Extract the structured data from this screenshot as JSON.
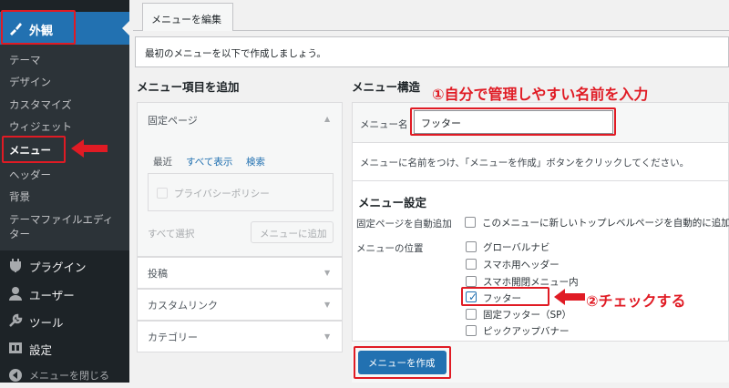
{
  "sidebar": {
    "appearance": "外観",
    "submenu": [
      "テーマ",
      "デザイン",
      "カスタマイズ",
      "ウィジェット",
      "メニュー",
      "ヘッダー",
      "背景",
      "テーマファイルエディ",
      "ター"
    ],
    "main": [
      "プラグイン",
      "ユーザー",
      "ツール",
      "設定",
      "メニューを閉じる"
    ]
  },
  "tab": "メニューを編集",
  "notice": "最初のメニューを以下で作成しましょう。",
  "add_items": {
    "heading": "メニュー項目を追加",
    "fixed_page": "固定ページ",
    "inner_tabs": [
      "最近",
      "すべて表示",
      "検索"
    ],
    "privacy": "プライバシーポリシー",
    "select_all": "すべて選択",
    "add_button": "メニューに追加",
    "sections": [
      "投稿",
      "カスタムリンク",
      "カテゴリー"
    ]
  },
  "structure": {
    "heading": "メニュー構造",
    "name_label": "メニュー名",
    "name_value": "フッター",
    "desc": "メニューに名前をつけ、「メニューを作成」ボタンをクリックしてください。",
    "settings_heading": "メニュー設定",
    "auto_add_label": "固定ページを自動追加",
    "auto_add_text": "このメニューに新しいトップレベルページを自動的に追加",
    "position_label": "メニューの位置",
    "positions": [
      "グローバルナビ",
      "スマホ用ヘッダー",
      "スマホ開閉メニュー内",
      "フッター",
      "固定フッター（SP）",
      "ピックアップバナー"
    ],
    "create_button": "メニューを作成"
  },
  "annotations": {
    "step1": "①自分で管理しやすい名前を入力",
    "step2": "②チェックする"
  },
  "colors": {
    "accent": "#2271b1",
    "annotation": "#e01b24",
    "sidebar": "#1d2327"
  }
}
